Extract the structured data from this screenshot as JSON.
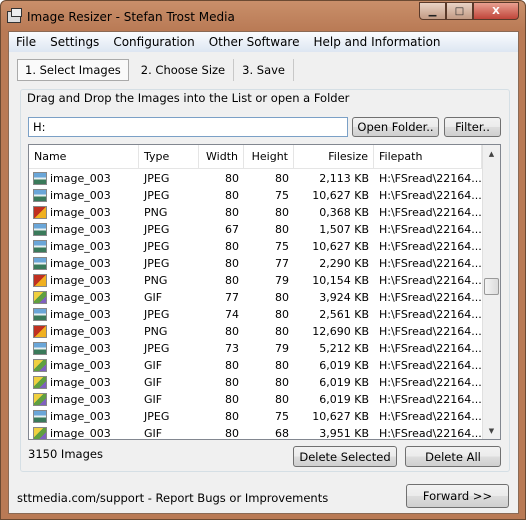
{
  "window": {
    "title": "Image Resizer - Stefan Trost Media",
    "minimize": "▁",
    "maximize": "□",
    "close": "X"
  },
  "menu": [
    "File",
    "Settings",
    "Configuration",
    "Other Software",
    "Help and Information"
  ],
  "tabs": [
    "1. Select Images",
    "2. Choose Size",
    "3. Save"
  ],
  "hint": "Drag and Drop the Images into the List or open a Folder",
  "path_input": "H:",
  "buttons": {
    "open_folder": "Open Folder..",
    "filter": "Filter..",
    "delete_selected": "Delete Selected",
    "delete_all": "Delete All",
    "forward": "Forward >>"
  },
  "list": {
    "columns": [
      "Name",
      "Type",
      "Width",
      "Height",
      "Filesize",
      "Filepath"
    ],
    "rows": [
      [
        "image_003",
        "JPEG",
        "80",
        "80",
        "2,113 KB",
        "H:\\FSread\\22164..."
      ],
      [
        "image_003",
        "JPEG",
        "80",
        "75",
        "10,627 KB",
        "H:\\FSread\\22164..."
      ],
      [
        "image_003",
        "PNG",
        "80",
        "80",
        "0,368 KB",
        "H:\\FSread\\22164..."
      ],
      [
        "image_003",
        "JPEG",
        "67",
        "80",
        "1,507 KB",
        "H:\\FSread\\22164..."
      ],
      [
        "image_003",
        "JPEG",
        "80",
        "75",
        "10,627 KB",
        "H:\\FSread\\22164..."
      ],
      [
        "image_003",
        "JPEG",
        "80",
        "77",
        "2,290 KB",
        "H:\\FSread\\22164..."
      ],
      [
        "image_003",
        "PNG",
        "80",
        "79",
        "10,154 KB",
        "H:\\FSread\\22164..."
      ],
      [
        "image_003",
        "GIF",
        "77",
        "80",
        "3,924 KB",
        "H:\\FSread\\22164..."
      ],
      [
        "image_003",
        "JPEG",
        "74",
        "80",
        "2,561 KB",
        "H:\\FSread\\22164..."
      ],
      [
        "image_003",
        "PNG",
        "80",
        "80",
        "12,690 KB",
        "H:\\FSread\\22164..."
      ],
      [
        "image_003",
        "JPEG",
        "73",
        "79",
        "5,212 KB",
        "H:\\FSread\\22164..."
      ],
      [
        "image_003",
        "GIF",
        "80",
        "80",
        "6,019 KB",
        "H:\\FSread\\22164..."
      ],
      [
        "image_003",
        "GIF",
        "80",
        "80",
        "6,019 KB",
        "H:\\FSread\\22164..."
      ],
      [
        "image_003",
        "GIF",
        "80",
        "80",
        "6,019 KB",
        "H:\\FSread\\22164..."
      ],
      [
        "image_003",
        "JPEG",
        "80",
        "75",
        "10,627 KB",
        "H:\\FSread\\22164..."
      ],
      [
        "image_003",
        "GIF",
        "80",
        "68",
        "3,951 KB",
        "H:\\FSread\\22164..."
      ]
    ]
  },
  "image_count": "3150 Images",
  "footer": "sttmedia.com/support - Report Bugs or Improvements"
}
